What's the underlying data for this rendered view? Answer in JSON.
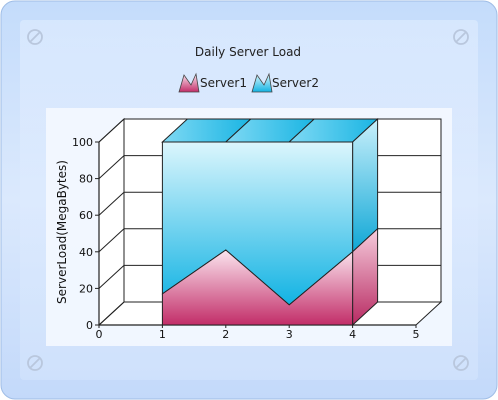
{
  "chart_data": {
    "type": "area",
    "style": "3d-stacked",
    "title": "Daily Server Load",
    "ylabel": "ServerLoad(MegaBytes)",
    "xlabel": "",
    "x": [
      1,
      2,
      3,
      4
    ],
    "xlim": [
      0,
      5
    ],
    "ylim": [
      0,
      100
    ],
    "xticks": [
      "0",
      "1",
      "2",
      "3",
      "4",
      "5"
    ],
    "yticks": [
      "0",
      "20",
      "40",
      "60",
      "80",
      "100"
    ],
    "series": [
      {
        "name": "Server1",
        "values": [
          17,
          41,
          11,
          40
        ]
      },
      {
        "name": "Server2",
        "values": [
          83,
          59,
          89,
          60
        ]
      }
    ],
    "legend_position": "top",
    "grid": true,
    "colors": {
      "server1": "#c2306a",
      "server2": "#10b8e6"
    }
  }
}
